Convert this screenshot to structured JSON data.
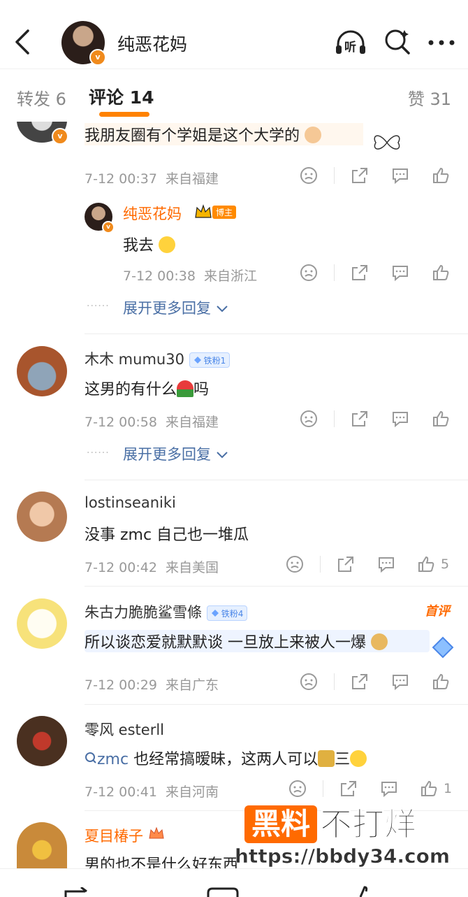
{
  "header": {
    "user_name": "纯恶花妈",
    "icons": [
      "back-icon",
      "listen-icon",
      "search-icon",
      "more-icon"
    ],
    "listen_label": "听"
  },
  "tabs": {
    "forward": "转发 6",
    "comments": "评论 14",
    "likes": "赞 31"
  },
  "comments": [
    {
      "text": "我朋友圈有个学姐是这个大学的",
      "time": "7-12 00:37",
      "location": "来自福建",
      "reply": {
        "name": "纯恶花妈",
        "badge": "博主",
        "text": "我去",
        "time": "7-12 00:38",
        "location": "来自浙江"
      },
      "expand": "展开更多回复"
    },
    {
      "name": "木木 mumu30",
      "badge": "铁粉1",
      "text_before": "这男的有什么",
      "text_after": "吗",
      "time": "7-12 00:58",
      "location": "来自福建",
      "expand": "展开更多回复"
    },
    {
      "name": "lostinseaniki",
      "text": "没事 zmc 自己也一堆瓜",
      "time": "7-12 00:42",
      "location": "来自美国",
      "likes": "5"
    },
    {
      "name": "朱古力脆脆鲨雪條",
      "badge": "铁粉4",
      "tag": "首评",
      "text": "所以谈恋爱就默默谈 一旦放上来被人一爆",
      "time": "7-12 00:29",
      "location": "来自广东"
    },
    {
      "name": "零风 esterll",
      "text_link": "zmc",
      "text": "也经常搞暧昧，这两人可以",
      "text_tail": "三",
      "time": "7-12 00:41",
      "location": "来自河南",
      "likes": "1"
    },
    {
      "name": "夏目椿子",
      "text": "男的也不是什么好东西"
    }
  ],
  "watermark": {
    "brand": "黑料",
    "slogan": "不打烊",
    "url": "https://bbdy34.com"
  },
  "colors": {
    "accent": "#ff8200",
    "link": "#4a6fa5",
    "muted": "#999999"
  }
}
